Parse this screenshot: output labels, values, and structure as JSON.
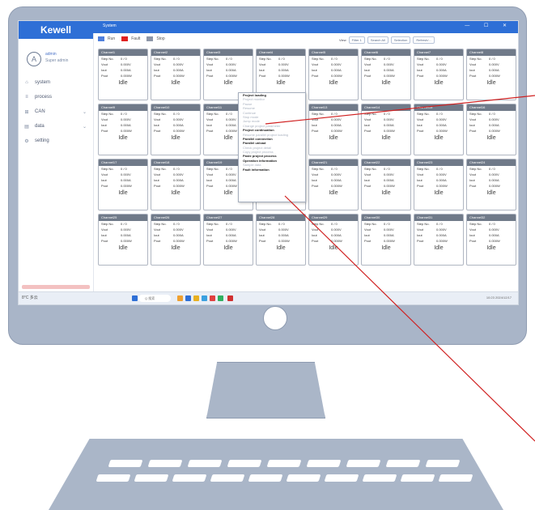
{
  "app": {
    "logo": "Kewell",
    "window_title": "System",
    "user": {
      "name": "admin",
      "role": "Super admin"
    },
    "nav": [
      {
        "label": "system",
        "icon": "home-icon",
        "chevron": false
      },
      {
        "label": "process",
        "icon": "process-icon",
        "chevron": false
      },
      {
        "label": "CAN",
        "icon": "can-icon",
        "chevron": true
      },
      {
        "label": "data",
        "icon": "data-icon",
        "chevron": true
      },
      {
        "label": "setting",
        "icon": "setting-icon",
        "chevron": false
      }
    ],
    "legend": [
      {
        "label": "Run",
        "color": "#4f7fdc"
      },
      {
        "label": "Fault",
        "color": "#e02020"
      },
      {
        "label": "Stop",
        "color": "#8d96a8"
      }
    ],
    "toolbar": {
      "view_label": "View",
      "view_value": "Filter 1",
      "buttons": [
        "Search All",
        "Selection",
        "Refresh/..."
      ]
    },
    "window_controls": "— ☐ ✕"
  },
  "card_fields": [
    "Step No.",
    "Vout",
    "Iout",
    "Pout"
  ],
  "card_values": [
    "0 / 0",
    "0.000V",
    "0.000A",
    "0.000W"
  ],
  "channels": [
    {
      "name": "Channel1",
      "status": "Idle"
    },
    {
      "name": "Channel2",
      "status": "Idle"
    },
    {
      "name": "Channel3",
      "status": "Idle"
    },
    {
      "name": "Channel4",
      "status": "Idle"
    },
    {
      "name": "Channel5",
      "status": "Idle"
    },
    {
      "name": "Channel6",
      "status": "Idle"
    },
    {
      "name": "Channel7",
      "status": "Idle"
    },
    {
      "name": "Channel8",
      "status": "Idle"
    },
    {
      "name": "Channel9",
      "status": "Idle"
    },
    {
      "name": "Channel10",
      "status": "Idle"
    },
    {
      "name": "Channel11",
      "status": "Idle"
    },
    {
      "name": "Channel12",
      "status": "Idle"
    },
    {
      "name": "Channel13",
      "status": "Idle"
    },
    {
      "name": "Channel14",
      "status": "Idle"
    },
    {
      "name": "Channel15",
      "status": "Idle"
    },
    {
      "name": "Channel16",
      "status": "Idle"
    },
    {
      "name": "Channel17",
      "status": "Idle"
    },
    {
      "name": "Channel18",
      "status": "Idle"
    },
    {
      "name": "Channel19",
      "status": "Idle"
    },
    {
      "name": "Channel20",
      "status": "Idle"
    },
    {
      "name": "Channel21",
      "status": "Idle"
    },
    {
      "name": "Channel22",
      "status": "Idle"
    },
    {
      "name": "Channel23",
      "status": "Idle"
    },
    {
      "name": "Channel24",
      "status": "Idle"
    },
    {
      "name": "Channel25",
      "status": "Idle"
    },
    {
      "name": "Channel26",
      "status": "Idle"
    },
    {
      "name": "Channel27",
      "status": "Idle"
    },
    {
      "name": "Channel28",
      "status": "Idle"
    },
    {
      "name": "Channel29",
      "status": "Idle"
    },
    {
      "name": "Channel30",
      "status": "Idle"
    },
    {
      "name": "Channel31",
      "status": "Idle"
    },
    {
      "name": "Channel32",
      "status": "Idle"
    }
  ],
  "context_menu": [
    {
      "label": "Project loading",
      "enabled": true
    },
    {
      "label": "Project monitor",
      "enabled": false
    },
    {
      "label": "Pause",
      "enabled": false
    },
    {
      "label": "Resume",
      "enabled": false
    },
    {
      "label": "Continue",
      "enabled": false
    },
    {
      "label": "Stop mode",
      "enabled": false
    },
    {
      "label": "Jump mode",
      "enabled": false
    },
    {
      "label": "Change project parameter",
      "enabled": false
    },
    {
      "label": "Project continuation",
      "enabled": true
    },
    {
      "label": "Resume parallel project loading",
      "enabled": false
    },
    {
      "label": "Parallel connection",
      "enabled": true
    },
    {
      "label": "Parallel unload",
      "enabled": true
    },
    {
      "label": "Check project detail",
      "enabled": false
    },
    {
      "label": "Copy project process",
      "enabled": false
    },
    {
      "label": "Paste project process",
      "enabled": true
    },
    {
      "label": "Operation information",
      "enabled": true
    },
    {
      "label": "Sample data",
      "enabled": false
    },
    {
      "label": "Fault information",
      "enabled": true
    }
  ],
  "taskbar": {
    "search_placeholder": "Q 搜索",
    "weather": "8°C 多云",
    "clock": "10:23 2024/12/17"
  }
}
